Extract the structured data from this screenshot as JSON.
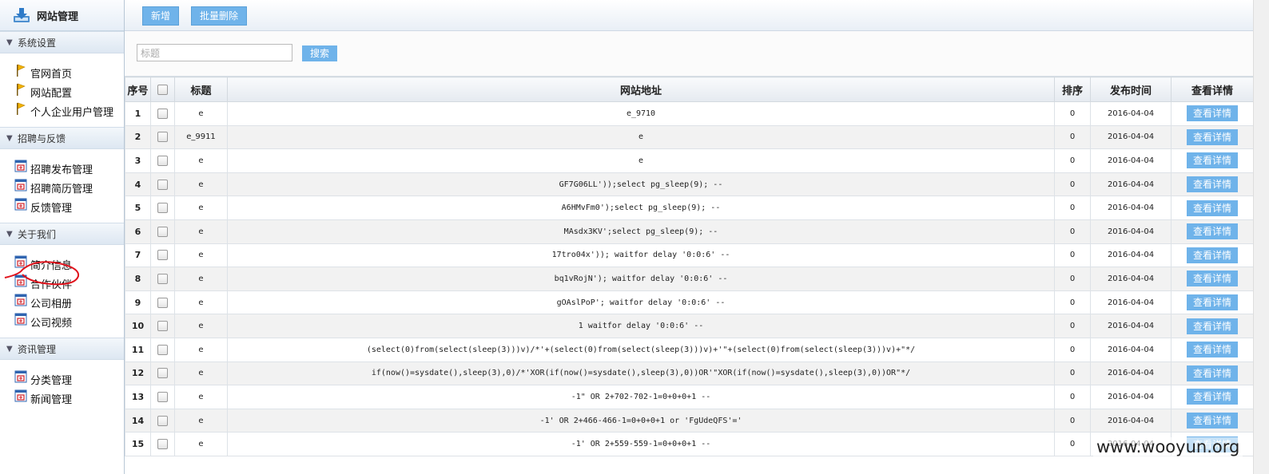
{
  "sidebar": {
    "title": "网站管理",
    "sections": [
      {
        "label": "系统设置",
        "items": [
          {
            "label": "官网首页",
            "icon": "flag-icon"
          },
          {
            "label": "网站配置",
            "icon": "flag-icon"
          },
          {
            "label": "个人企业用户管理",
            "icon": "flag-icon"
          }
        ]
      },
      {
        "label": "招聘与反馈",
        "items": [
          {
            "label": "招聘发布管理",
            "icon": "doc-icon"
          },
          {
            "label": "招聘简历管理",
            "icon": "doc-icon"
          },
          {
            "label": "反馈管理",
            "icon": "doc-icon"
          }
        ]
      },
      {
        "label": "关于我们",
        "items": [
          {
            "label": "简介信息",
            "icon": "doc-icon"
          },
          {
            "label": "合作伙伴",
            "icon": "doc-icon"
          },
          {
            "label": "公司相册",
            "icon": "doc-icon"
          },
          {
            "label": "公司视频",
            "icon": "doc-icon"
          }
        ]
      },
      {
        "label": "资讯管理",
        "items": [
          {
            "label": "分类管理",
            "icon": "doc-icon"
          },
          {
            "label": "新闻管理",
            "icon": "doc-icon"
          }
        ]
      }
    ]
  },
  "toolbar": {
    "add_label": "新增",
    "batch_delete_label": "批量删除"
  },
  "search": {
    "placeholder": "标题",
    "button_label": "搜索"
  },
  "table": {
    "headers": {
      "index": "序号",
      "title": "标题",
      "url": "网站地址",
      "sort": "排序",
      "date": "发布时间",
      "detail": "查看详情"
    },
    "detail_button": "查看详情",
    "rows": [
      {
        "index": "1",
        "title": "e",
        "url": "e_9710",
        "sort": "0",
        "date": "2016-04-04"
      },
      {
        "index": "2",
        "title": "e_9911",
        "url": "e",
        "sort": "0",
        "date": "2016-04-04"
      },
      {
        "index": "3",
        "title": "e",
        "url": "e",
        "sort": "0",
        "date": "2016-04-04"
      },
      {
        "index": "4",
        "title": "e",
        "url": "GF7G06LL'));select pg_sleep(9); --",
        "sort": "0",
        "date": "2016-04-04"
      },
      {
        "index": "5",
        "title": "e",
        "url": "A6HMvFm0');select pg_sleep(9); --",
        "sort": "0",
        "date": "2016-04-04"
      },
      {
        "index": "6",
        "title": "e",
        "url": "MAsdx3KV';select pg_sleep(9); --",
        "sort": "0",
        "date": "2016-04-04"
      },
      {
        "index": "7",
        "title": "e",
        "url": "17tro04x')); waitfor delay '0:0:6' --",
        "sort": "0",
        "date": "2016-04-04"
      },
      {
        "index": "8",
        "title": "e",
        "url": "bq1vRojN'); waitfor delay '0:0:6' --",
        "sort": "0",
        "date": "2016-04-04"
      },
      {
        "index": "9",
        "title": "e",
        "url": "gOAslPoP'; waitfor delay '0:0:6' --",
        "sort": "0",
        "date": "2016-04-04"
      },
      {
        "index": "10",
        "title": "e",
        "url": "1 waitfor delay '0:0:6' --",
        "sort": "0",
        "date": "2016-04-04"
      },
      {
        "index": "11",
        "title": "e",
        "url": "(select(0)from(select(sleep(3)))v)/*'+(select(0)from(select(sleep(3)))v)+'\"+(select(0)from(select(sleep(3)))v)+\"*/",
        "sort": "0",
        "date": "2016-04-04"
      },
      {
        "index": "12",
        "title": "e",
        "url": "if(now()=sysdate(),sleep(3),0)/*'XOR(if(now()=sysdate(),sleep(3),0))OR'\"XOR(if(now()=sysdate(),sleep(3),0))OR\"*/",
        "sort": "0",
        "date": "2016-04-04"
      },
      {
        "index": "13",
        "title": "e",
        "url": "-1\" OR 2+702-702-1=0+0+0+1 --",
        "sort": "0",
        "date": "2016-04-04"
      },
      {
        "index": "14",
        "title": "e",
        "url": "-1' OR 2+466-466-1=0+0+0+1 or 'FgUdeQFS'='",
        "sort": "0",
        "date": "2016-04-04"
      },
      {
        "index": "15",
        "title": "e",
        "url": "-1' OR 2+559-559-1=0+0+0+1 --",
        "sort": "0",
        "date": "2016-04-04"
      }
    ]
  },
  "watermark": "www.wooyun.org",
  "colors": {
    "accent": "#6fb3ea",
    "annotation": "#e0121c"
  }
}
